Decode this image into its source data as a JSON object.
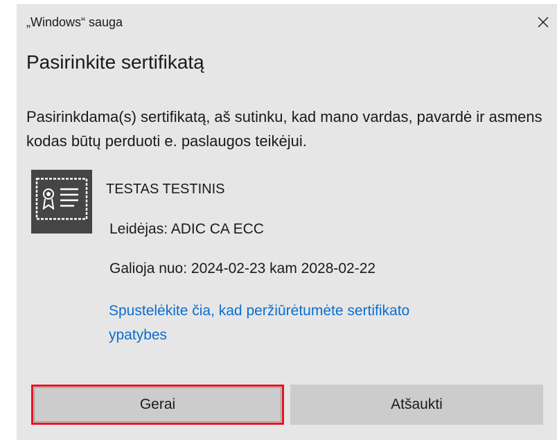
{
  "window": {
    "title": "„Windows“ sauga"
  },
  "dialog": {
    "heading": "Pasirinkite sertifikatą",
    "description": "Pasirinkdama(s) sertifikatą, aš sutinku, kad mano vardas, pavardė ir asmens kodas būtų perduoti e. paslaugos teikėjui."
  },
  "certificate": {
    "icon": "certificate-icon",
    "name": "TESTAS TESTINIS",
    "issuer": "Leidėjas: ADIC CA ECC",
    "validity": "Galioja nuo: 2024-02-23 kam 2028-02-22",
    "details_link": "Spustelėkite čia, kad peržiūrėtumėte sertifikato ypatybes"
  },
  "buttons": {
    "ok": "Gerai",
    "cancel": "Atšaukti"
  },
  "colors": {
    "background": "#e6e6e6",
    "link": "#0a6ed1",
    "button": "#cccccc",
    "focus_highlight": "#e81123",
    "icon": "#454545"
  }
}
